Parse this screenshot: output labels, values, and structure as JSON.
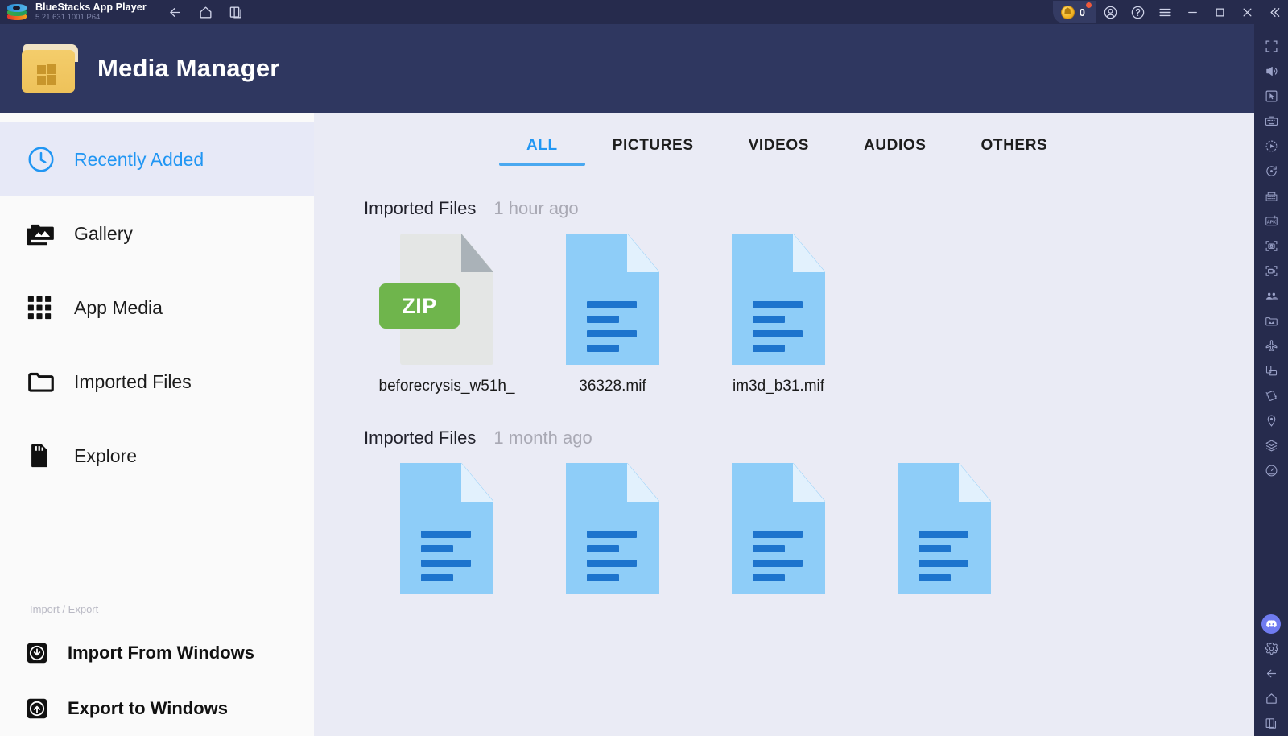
{
  "titlebar": {
    "app_name": "BlueStacks App Player",
    "version": "5.21.631.1001  P64",
    "nav": [
      {
        "name": "back-icon",
        "label": "Back"
      },
      {
        "name": "home-icon",
        "label": "Home"
      },
      {
        "name": "multi-instance-icon",
        "label": "Instances"
      }
    ],
    "coin_count": "0",
    "right_buttons": [
      {
        "name": "account-icon",
        "label": "Account"
      },
      {
        "name": "help-icon",
        "label": "Help"
      },
      {
        "name": "menu-icon",
        "label": "Menu"
      },
      {
        "name": "minimize-icon",
        "label": "Minimize"
      },
      {
        "name": "maximize-icon",
        "label": "Maximize"
      },
      {
        "name": "close-icon",
        "label": "Close"
      },
      {
        "name": "collapse-icon",
        "label": "Collapse"
      }
    ]
  },
  "media_manager": {
    "title": "Media Manager",
    "sidebar": {
      "items": [
        {
          "label": "Recently Added",
          "icon": "clock-icon",
          "active": true
        },
        {
          "label": "Gallery",
          "icon": "photo-folder-icon",
          "active": false
        },
        {
          "label": "App Media",
          "icon": "grid-icon",
          "active": false
        },
        {
          "label": "Imported Files",
          "icon": "folder-icon",
          "active": false
        },
        {
          "label": "Explore",
          "icon": "sd-card-icon",
          "active": false
        }
      ],
      "section_label": "Import / Export",
      "io_items": [
        {
          "label": "Import From Windows",
          "icon": "download-box-icon"
        },
        {
          "label": "Export to Windows",
          "icon": "upload-box-icon"
        }
      ]
    },
    "tabs": [
      {
        "label": "ALL",
        "active": true
      },
      {
        "label": "PICTURES",
        "active": false
      },
      {
        "label": "VIDEOS",
        "active": false
      },
      {
        "label": "AUDIOS",
        "active": false
      },
      {
        "label": "OTHERS",
        "active": false
      }
    ],
    "groups": [
      {
        "title": "Imported Files",
        "time": "1 hour ago",
        "files": [
          {
            "name": "beforecrysis_w51h_",
            "type": "zip",
            "badge": "ZIP"
          },
          {
            "name": "36328.mif",
            "type": "document"
          },
          {
            "name": "im3d_b31.mif",
            "type": "document"
          }
        ]
      },
      {
        "title": "Imported Files",
        "time": "1 month ago",
        "files": [
          {
            "name": "",
            "type": "document"
          },
          {
            "name": "",
            "type": "document"
          },
          {
            "name": "",
            "type": "document"
          },
          {
            "name": "",
            "type": "document"
          }
        ]
      }
    ]
  },
  "rail": {
    "icons": [
      {
        "name": "fullscreen-icon"
      },
      {
        "name": "volume-icon"
      },
      {
        "name": "cursor-control-icon"
      },
      {
        "name": "keyboard-controls-icon"
      },
      {
        "name": "macro-recorder-icon"
      },
      {
        "name": "rotate-icon"
      },
      {
        "name": "multi-instance-manager-icon"
      },
      {
        "name": "install-apk-icon"
      },
      {
        "name": "screenshot-icon"
      },
      {
        "name": "screen-record-icon"
      },
      {
        "name": "eco-mode-icon"
      },
      {
        "name": "media-manager-icon"
      },
      {
        "name": "airplane-icon"
      },
      {
        "name": "rotate-device-icon"
      },
      {
        "name": "shake-icon"
      },
      {
        "name": "location-icon"
      },
      {
        "name": "layers-icon"
      },
      {
        "name": "performance-icon"
      }
    ],
    "bottom_icons": [
      {
        "name": "discord-icon"
      },
      {
        "name": "settings-gear-icon"
      },
      {
        "name": "android-back-icon"
      },
      {
        "name": "android-home-icon"
      },
      {
        "name": "android-recents-icon"
      }
    ]
  },
  "colors": {
    "titlebar_bg": "#262b4d",
    "header_bg": "#2f3760",
    "content_bg": "#eaebf5",
    "sidebar_bg": "#fafafa",
    "accent_blue": "#2196f3",
    "active_row_bg": "#e7e9f7",
    "doc_blue": "#8ecdf8",
    "doc_line": "#1d74cd",
    "zip_green": "#6fb54c",
    "folder_gold": "#f4cd6b"
  }
}
